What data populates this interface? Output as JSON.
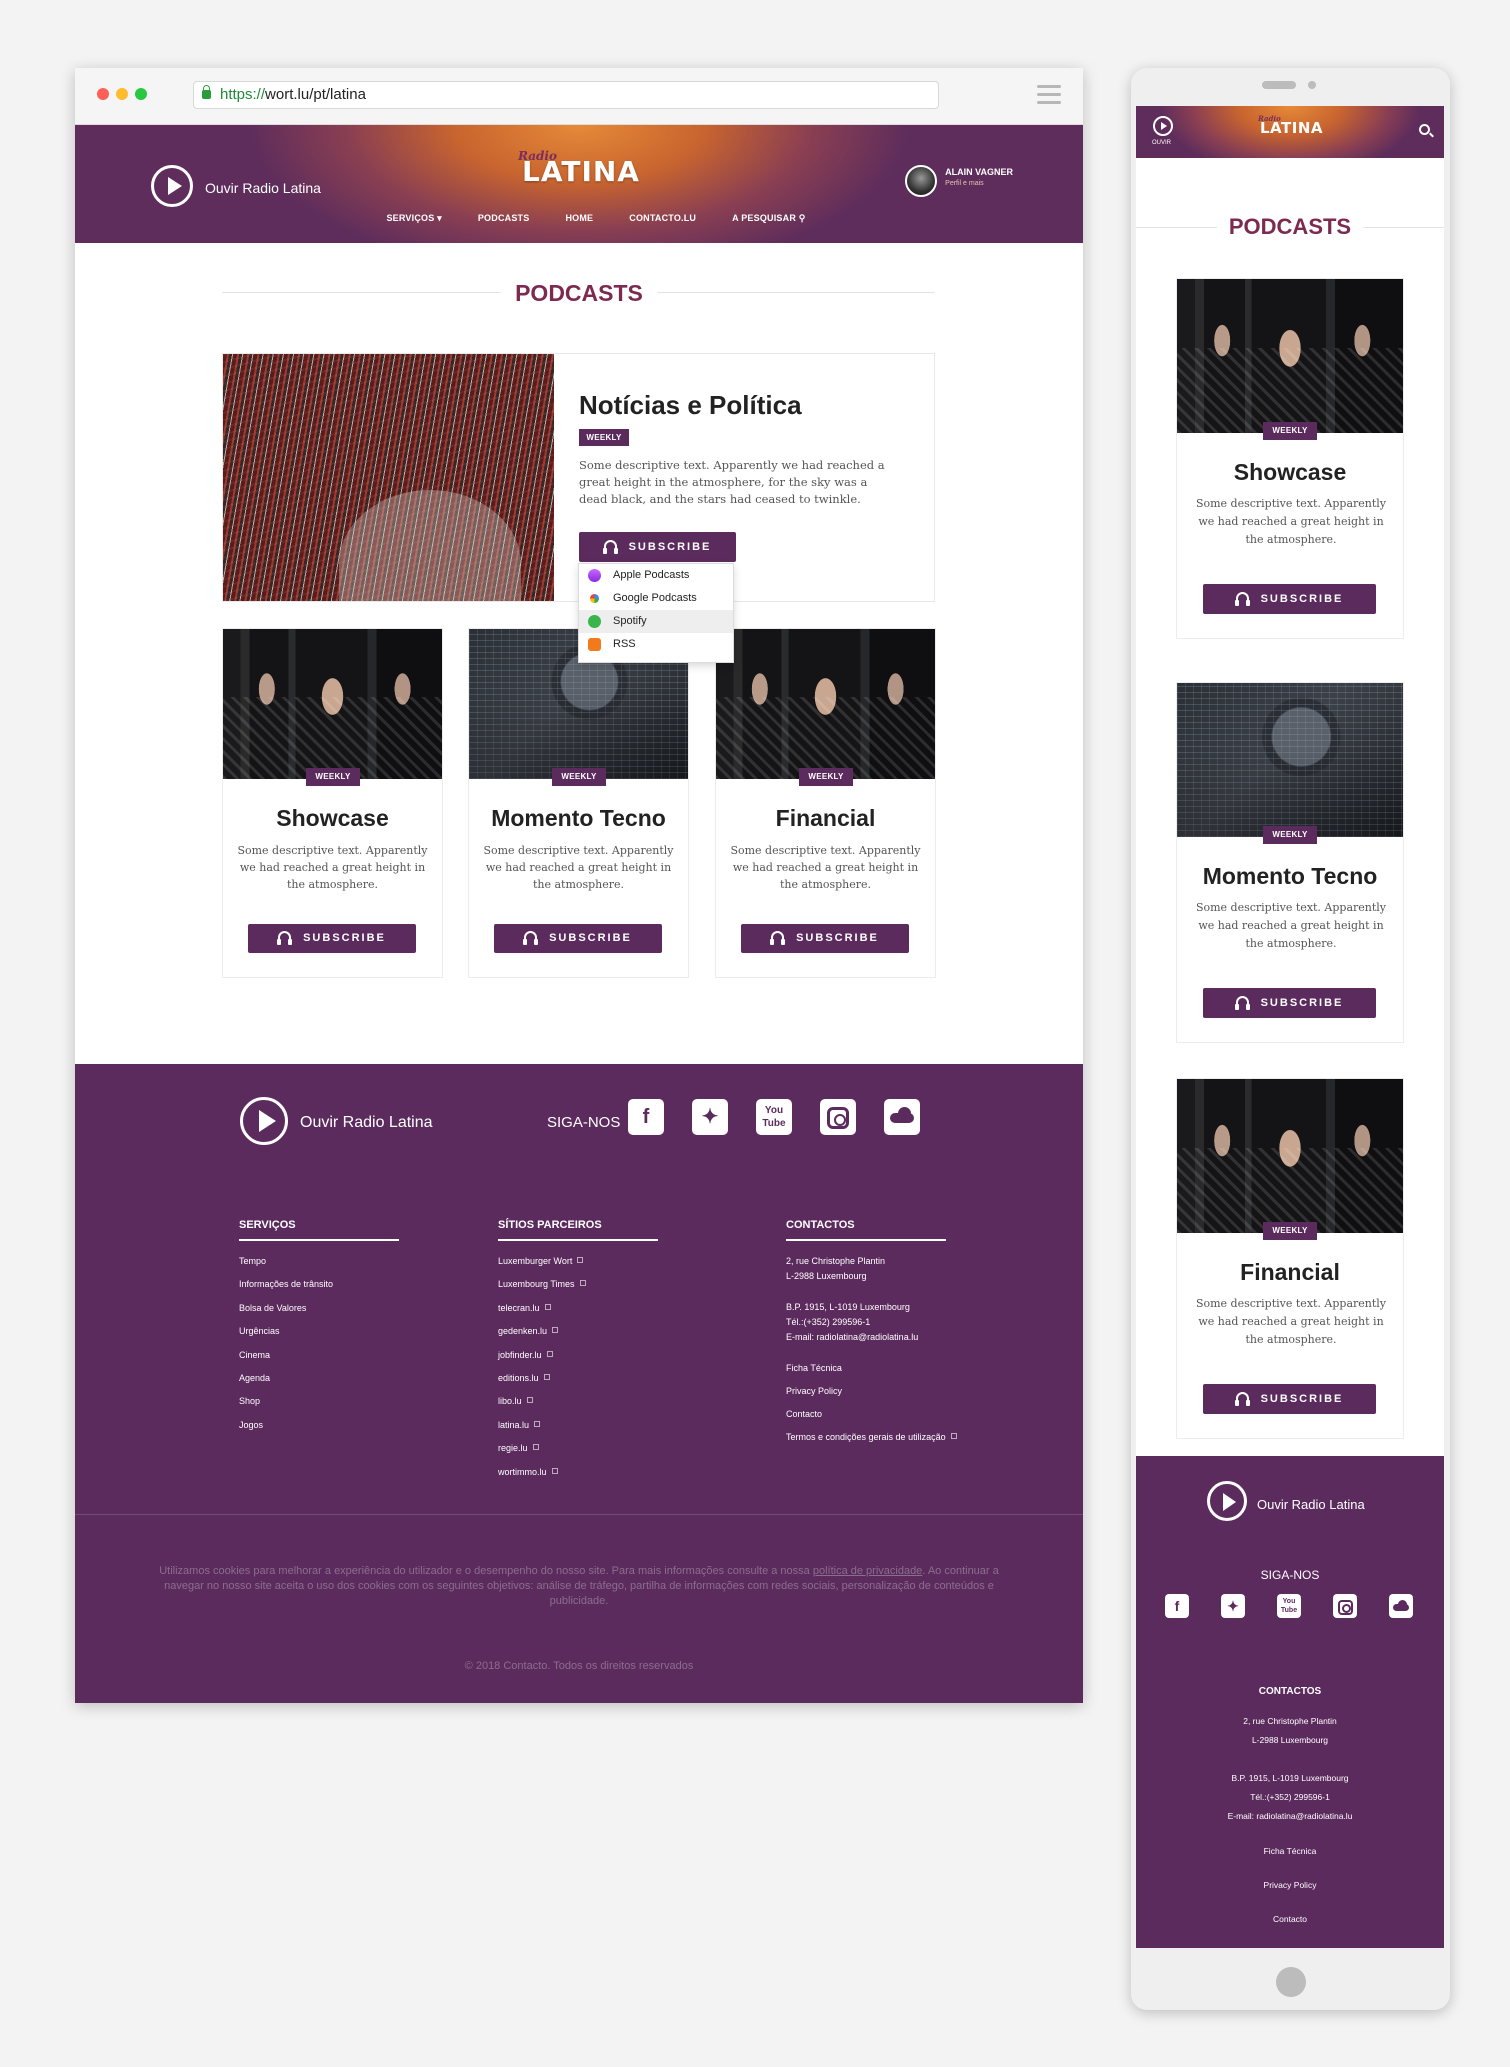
{
  "browser": {
    "url_scheme": "https://",
    "url_rest": "wort.lu/pt/latina"
  },
  "header": {
    "listen_label": "Ouvir Radio Latina",
    "logo_small": "Radio",
    "logo_main": "LATINA",
    "nav": [
      "SERVIÇOS",
      "PODCASTS",
      "HOME",
      "CONTACTO.LU",
      "A PESQUISAR"
    ],
    "user_name": "ALAIN VAGNER",
    "user_sub": "Perfil e mais"
  },
  "page_title": "PODCASTS",
  "featured": {
    "title": "Notícias e Política",
    "badge": "WEEKLY",
    "description": "Some descriptive text. Apparently we had reached a great height in the atmosphere, for the sky was a dead black, and the stars had ceased to twinkle.",
    "button": "SUBSCRIBE",
    "dropdown": [
      "Apple Podcasts",
      "Google Podcasts",
      "Spotify",
      "RSS"
    ]
  },
  "cards": [
    {
      "title": "Showcase",
      "badge": "WEEKLY",
      "description": "Some descriptive text. Apparently we had reached a great height in the atmosphere.",
      "button": "SUBSCRIBE"
    },
    {
      "title": "Momento Tecno",
      "badge": "WEEKLY",
      "description": "Some descriptive text. Apparently we had reached a great height in the atmosphere.",
      "button": "SUBSCRIBE"
    },
    {
      "title": "Financial",
      "badge": "WEEKLY",
      "description": "Some descriptive text. Apparently we had reached a great height in the atmosphere.",
      "button": "SUBSCRIBE"
    }
  ],
  "footer": {
    "listen_label": "Ouvir Radio Latina",
    "follow": "SIGA-NOS",
    "social": [
      "facebook-icon",
      "twitter-icon",
      "youtube-icon",
      "instagram-icon",
      "soundcloud-icon"
    ],
    "youtube_top": "You",
    "youtube_bottom": "Tube",
    "services_title": "SERVIÇOS",
    "services": [
      "Tempo",
      "Informações de trânsito",
      "Bolsa de Valores",
      "Urgências",
      "Cinema",
      "Agenda",
      "Shop",
      "Jogos"
    ],
    "partners_title": "SÍTIOS PARCEIROS",
    "partners": [
      "Luxemburger Wort",
      "Luxembourg Times",
      "telecran.lu",
      "gedenken.lu",
      "jobfinder.lu",
      "editions.lu",
      "libo.lu",
      "latina.lu",
      "regie.lu",
      "wortimmo.lu"
    ],
    "contacts_title": "CONTACTOS",
    "address1": "2, rue Christophe Plantin",
    "address2": "L-2988 Luxembourg",
    "bp": "B.P. 1915, L-1019 Luxembourg",
    "tel": "Tél.:(+352) 299596-1",
    "email": "E-mail: radiolatina@radiolatina.lu",
    "links": [
      "Ficha Técnica",
      "Privacy Policy",
      "Contacto",
      "Termos e condições gerais de utilização"
    ],
    "cookie_before": "Utilizamos cookies para melhorar a experiência do utilizador e o desempenho do nosso site. Para mais informações consulte a nossa ",
    "cookie_link": "política de privacidade",
    "cookie_after": ". Ao continuar a navegar no nosso site aceita o uso dos cookies com os seguintes objetivos: análise de tráfego, partilha de informações com redes sociais, personalização de conteúdos e publicidade.",
    "copyright": "© 2018 Contacto. Todos os direitos reservados"
  },
  "mobile": {
    "listen_short": "OUVIR",
    "logo_small": "Radio",
    "logo_main": "LATINA",
    "page_title": "PODCASTS",
    "footer_listen": "Ouvir Radio Latina",
    "follow": "SIGA-NOS",
    "contacts_title": "CONTACTOS",
    "address1": "2, rue Christophe Plantin",
    "address2": "L-2988 Luxembourg",
    "bp": "B.P. 1915, L-1019 Luxembourg",
    "tel": "Tél.:(+352) 299596-1",
    "email": "E-mail: radiolatina@radiolatina.lu",
    "links": [
      "Ficha Técnica",
      "Privacy Policy",
      "Contacto"
    ]
  },
  "colors": {
    "brand_purple": "#5c2b5e",
    "title_wine": "#7c2a4f",
    "header_orange": "#e68a38"
  }
}
